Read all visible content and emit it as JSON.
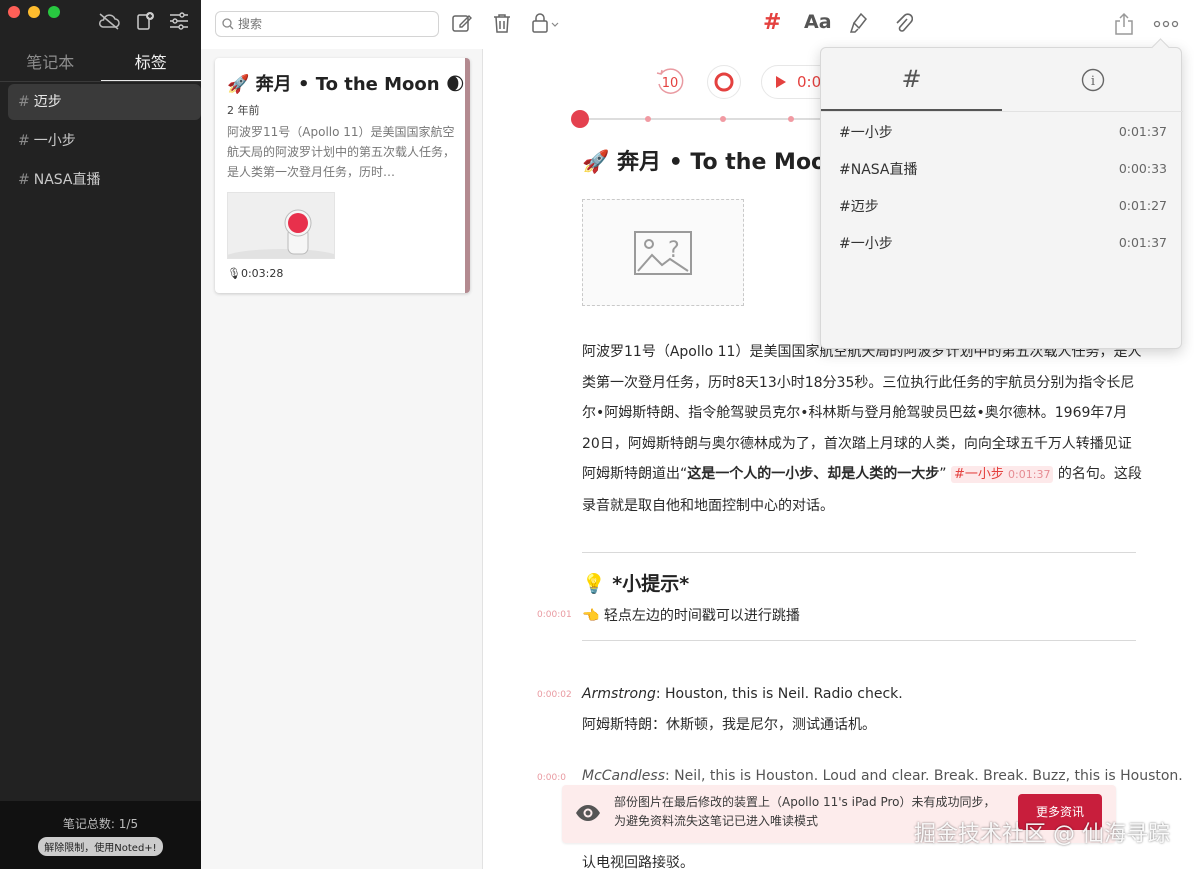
{
  "sidebar": {
    "tabs": [
      "笔记本",
      "标签"
    ],
    "active_tab": "标签",
    "tags": [
      {
        "label": "迈步",
        "selected": true
      },
      {
        "label": "一小步",
        "selected": false
      },
      {
        "label": "NASA直播",
        "selected": false
      }
    ],
    "note_count": "笔记总数: 1/5",
    "unlock_label": "解除限制，使用Noted+!"
  },
  "toolbar": {
    "search_placeholder": "搜索",
    "hash_label": "#",
    "font_label": "Aa"
  },
  "note_card": {
    "title": "🚀 奔月 • To the Moon 🌒",
    "age": "2 年前",
    "excerpt": "阿波罗11号（Apollo 11）是美国国家航空航天局的阿波罗计划中的第五次载人任务，是人类第一次登月任务，历时…",
    "duration": "0:03:28"
  },
  "player": {
    "skip_label": "10",
    "time": "0:0"
  },
  "editor": {
    "title": "🚀 奔月 • To the Moon",
    "para1": "阿波罗11号（Apollo 11）是美国国家航空航天局的阿波罗计划中的第五次载人任务，是人类第一次登月任务，历时8天13小时18分35秒。三位执行此任务的宇航员分别为指令长尼尔•阿姆斯特朗、指令舱驾驶员克尔•科林斯与登月舱驾驶员巴兹•奥尔德林。1969年7月20日，阿姆斯特朗与奥尔德林成为了，首次踏上月球的人类，向向全球五千万人转播见证阿姆斯特朗道出“",
    "para_bold": "这是一个人的一小步、却是人类的一大步",
    "para_quote_end": "”",
    "inline_tag": "#一小步",
    "inline_tag_time": "0:01:37",
    "para2": " 的名句。这段录音就是取自他和地面控制中心的对话。",
    "tip_heading": "💡 *小提示*",
    "tip_stamp": "0:00:01",
    "tip_text": "👈 轻点左边的时间戳可以进行跳播",
    "dialog": [
      {
        "stamp": "0:00:02",
        "speaker": "Armstrong",
        "text": ": Houston, this is Neil. Radio check."
      },
      {
        "stamp": "",
        "speaker": "",
        "text": "阿姆斯特朗：休斯顿，我是尼尔，测试通话机。"
      },
      {
        "stamp": "0:00:0",
        "speaker": "McCandless",
        "text": ": Neil, this is Houston. Loud and clear. Break. Break. Buzz, this is Houston."
      }
    ],
    "last_line": "认电视回路接驳。"
  },
  "banner": {
    "text": "部份图片在最后修改的装置上（Apollo 11's iPad Pro）未有成功同步，为避免资料流失这笔记已进入唯读模式",
    "button": "更多资讯"
  },
  "popover": {
    "tabs": [
      "#",
      "i"
    ],
    "rows": [
      {
        "tag": "#一小步",
        "time": "0:01:37"
      },
      {
        "tag": "#NASA直播",
        "time": "0:00:33"
      },
      {
        "tag": "#迈步",
        "time": "0:01:27"
      },
      {
        "tag": "#一小步",
        "time": "0:01:37"
      }
    ]
  },
  "watermark": "掘金技术社区 @ 仙海寻踪",
  "colors": {
    "accent": "#e4413f",
    "sidebar": "#222222",
    "banner_button": "#c81e3c"
  }
}
